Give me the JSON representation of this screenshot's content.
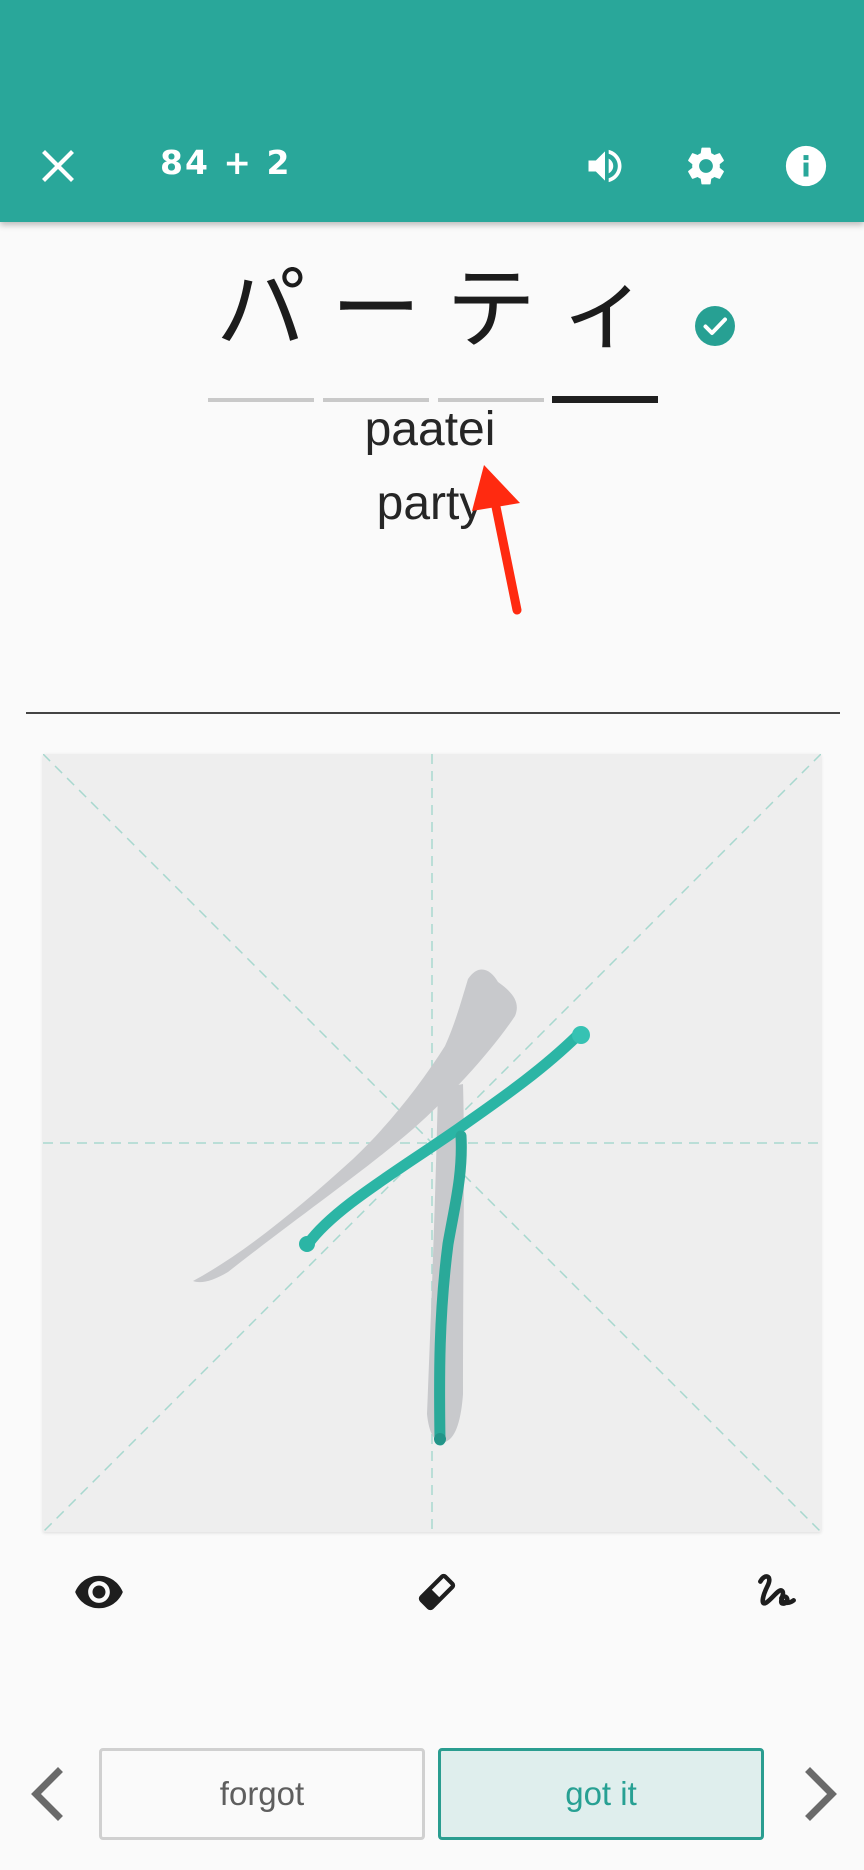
{
  "appbar": {
    "counter": "84 + 2",
    "color": "#29a79a",
    "icons": [
      "close-icon",
      "volume-icon",
      "settings-icon",
      "info-icon"
    ]
  },
  "word": {
    "kana": [
      "パ",
      "ー",
      "テ",
      "ィ"
    ],
    "active_index": 3,
    "completed_icon": "check-circle-icon",
    "romaji": "paatei",
    "meaning": "party"
  },
  "annotation": {
    "arrow_color": "#ff2a10"
  },
  "pad": {
    "guide_color": "#a8d8cf",
    "hint_stroke_color": "#c8c9cc",
    "drawn_stroke_color": "#2bb5a5"
  },
  "tools": {
    "icons": [
      "eye-icon",
      "eraser-icon",
      "stroke-icon"
    ]
  },
  "buttons": {
    "forgot_label": "forgot",
    "got_it_label": "got it",
    "prev_icon": "chevron-left-icon",
    "next_icon": "chevron-right-icon"
  }
}
